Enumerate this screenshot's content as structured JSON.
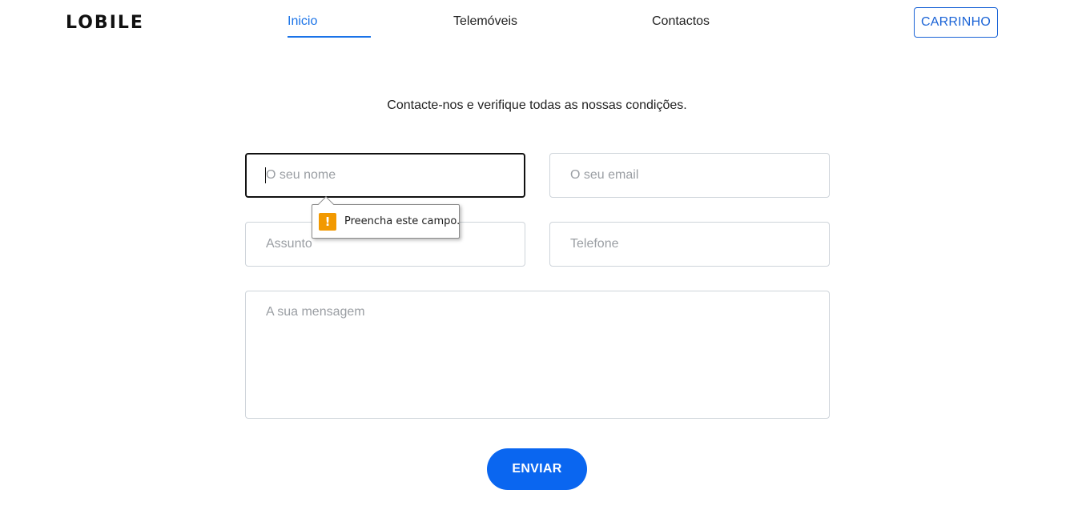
{
  "header": {
    "logo": "LOBILE",
    "nav": [
      {
        "label": "Inicio",
        "active": true
      },
      {
        "label": "Telemóveis",
        "active": false
      },
      {
        "label": "Contactos",
        "active": false
      }
    ],
    "cart_label": "CARRINHO"
  },
  "intro": "Contacte-nos e verifique todas as nossas condições.",
  "form": {
    "name": {
      "placeholder": "O seu nome",
      "value": ""
    },
    "email": {
      "placeholder": "O seu email",
      "value": ""
    },
    "subject": {
      "placeholder": "Assunto",
      "value": ""
    },
    "phone": {
      "placeholder": "Telefone",
      "value": ""
    },
    "message": {
      "placeholder": "A sua mensagem",
      "value": ""
    },
    "submit_label": "ENVIAR"
  },
  "validation": {
    "icon": "warning-icon",
    "message": "Preencha este campo."
  },
  "colors": {
    "accent": "#1a73e8",
    "button": "#0a66f0",
    "warning": "#f29900"
  }
}
